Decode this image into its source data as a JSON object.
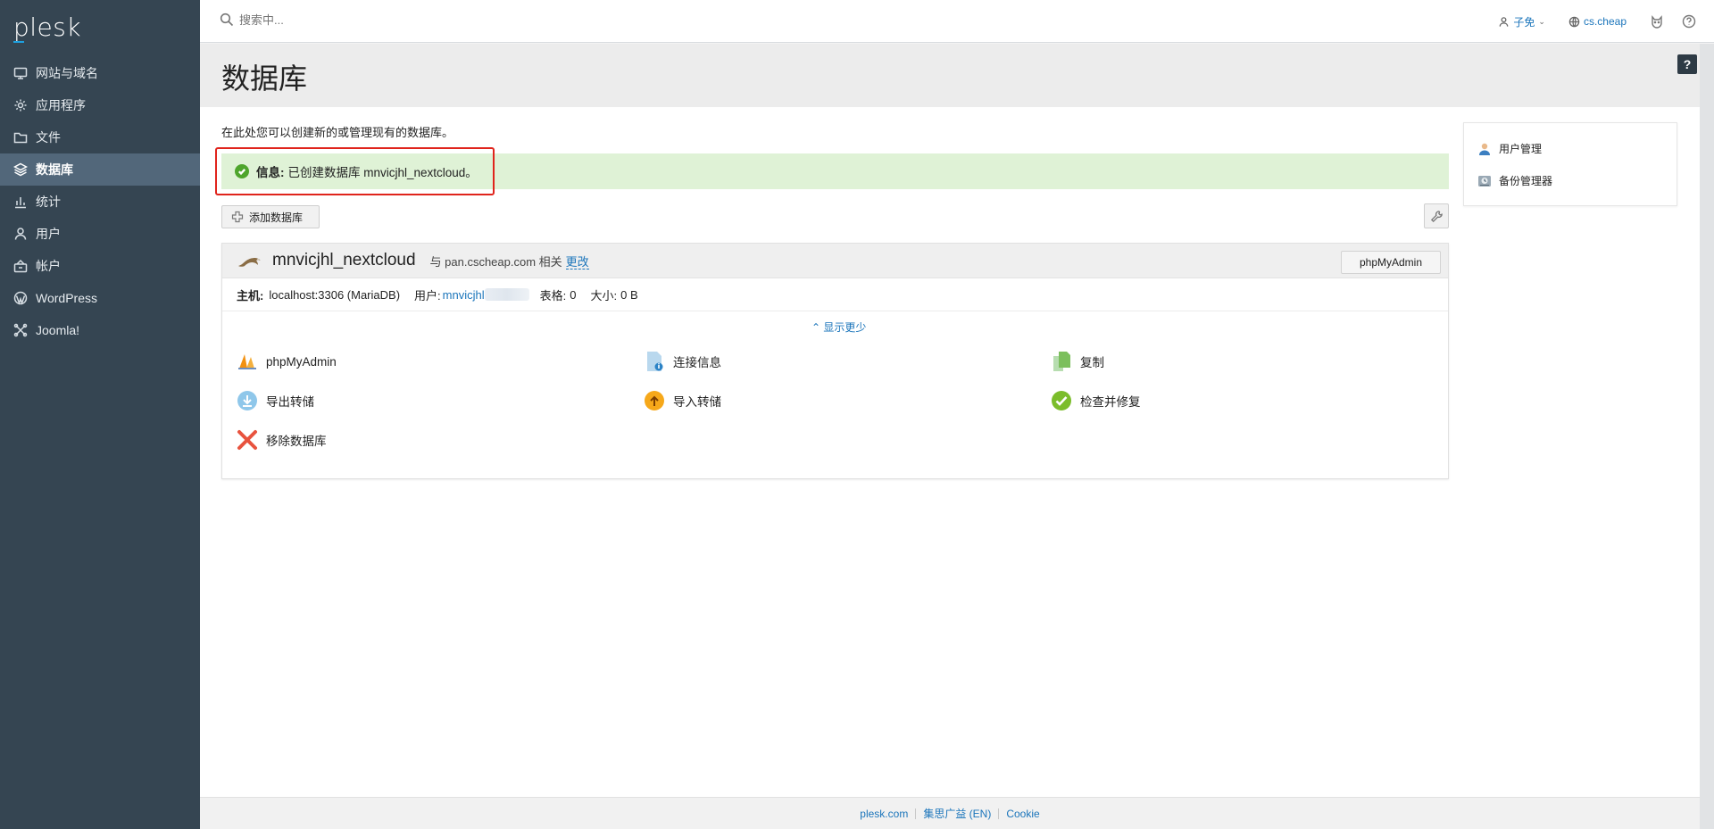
{
  "sidebar": {
    "logo": "plesk",
    "items": [
      {
        "label": "网站与域名",
        "icon": "monitor-icon"
      },
      {
        "label": "应用程序",
        "icon": "gear-icon"
      },
      {
        "label": "文件",
        "icon": "folder-icon"
      },
      {
        "label": "数据库",
        "icon": "layers-icon",
        "active": true
      },
      {
        "label": "统计",
        "icon": "bar-chart-icon"
      },
      {
        "label": "用户",
        "icon": "user-icon"
      },
      {
        "label": "帐户",
        "icon": "account-icon"
      },
      {
        "label": "WordPress",
        "icon": "wordpress-icon"
      },
      {
        "label": "Joomla!",
        "icon": "joomla-icon"
      }
    ]
  },
  "topbar": {
    "search_placeholder": "搜索中...",
    "user_name": "子免",
    "domain": "cs.cheap"
  },
  "page": {
    "title": "数据库",
    "help": "?",
    "intro": "在此处您可以创建新的或管理现有的数据库。"
  },
  "message": {
    "label": "信息:",
    "text": "已创建数据库 mnvicjhl_nextcloud。"
  },
  "toolbar": {
    "add_label": "添加数据库"
  },
  "database": {
    "name": "mnvicjhl_nextcloud",
    "related_text": "与 pan.cscheap.com 相关",
    "change_link": "更改",
    "pma_button": "phpMyAdmin",
    "host_label": "主机:",
    "host_value": "localhost:3306 (MariaDB)",
    "user_label": "用户:",
    "user_value": "mnvicjhl",
    "tables_label": "表格:",
    "tables_value": "0",
    "size_label": "大小:",
    "size_value": "0 B",
    "toggle": "显示更少",
    "actions": [
      {
        "label": "phpMyAdmin",
        "icon": "phpmyadmin-icon"
      },
      {
        "label": "连接信息",
        "icon": "connection-info-icon"
      },
      {
        "label": "复制",
        "icon": "copy-icon"
      },
      {
        "label": "导出转储",
        "icon": "export-dump-icon"
      },
      {
        "label": "导入转储",
        "icon": "import-dump-icon"
      },
      {
        "label": "检查并修复",
        "icon": "check-repair-icon"
      },
      {
        "label": "移除数据库",
        "icon": "remove-icon"
      }
    ]
  },
  "side_panel": {
    "items": [
      {
        "label": "用户管理",
        "icon": "user-management-icon"
      },
      {
        "label": "备份管理器",
        "icon": "backup-manager-icon"
      }
    ]
  },
  "footer": {
    "links": [
      "plesk.com",
      "集思广益 (EN)",
      "Cookie"
    ]
  },
  "colors": {
    "sidebar_bg": "#354552",
    "sidebar_active": "#52677a",
    "link": "#1b75bb",
    "success_bg": "#dff2d6",
    "highlight": "#e0241c"
  }
}
